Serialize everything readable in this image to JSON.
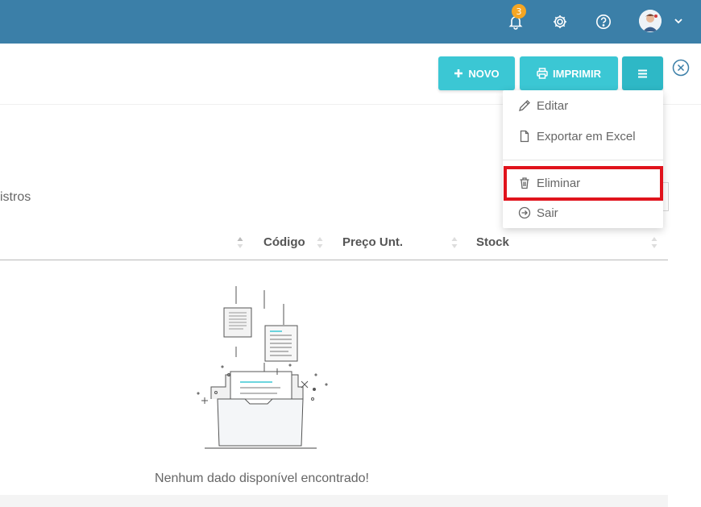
{
  "header": {
    "notification_count": "3",
    "icons": [
      "bell-icon",
      "gear-icon",
      "help-icon",
      "avatar",
      "chevron-down-icon"
    ]
  },
  "toolbar": {
    "new_label": "NOVO",
    "print_label": "IMPRIMIR"
  },
  "dropdown": {
    "items": [
      {
        "label": "Editar",
        "icon": "pencil-icon"
      },
      {
        "label": "Exportar em Excel",
        "icon": "file-icon"
      },
      {
        "label": "Eliminar",
        "icon": "trash-icon"
      },
      {
        "label": "Sair",
        "icon": "exit-circle-icon"
      }
    ]
  },
  "table": {
    "records_text": "istros",
    "columns": [
      "Código",
      "Preço Unt.",
      "Stock"
    ],
    "empty_message": "Nenhum dado disponível encontrado!"
  },
  "colors": {
    "header_bg": "#3b7fa8",
    "button_bg": "#3bc7d4",
    "badge_bg": "#f5a623",
    "highlight_border": "#e0131c"
  }
}
